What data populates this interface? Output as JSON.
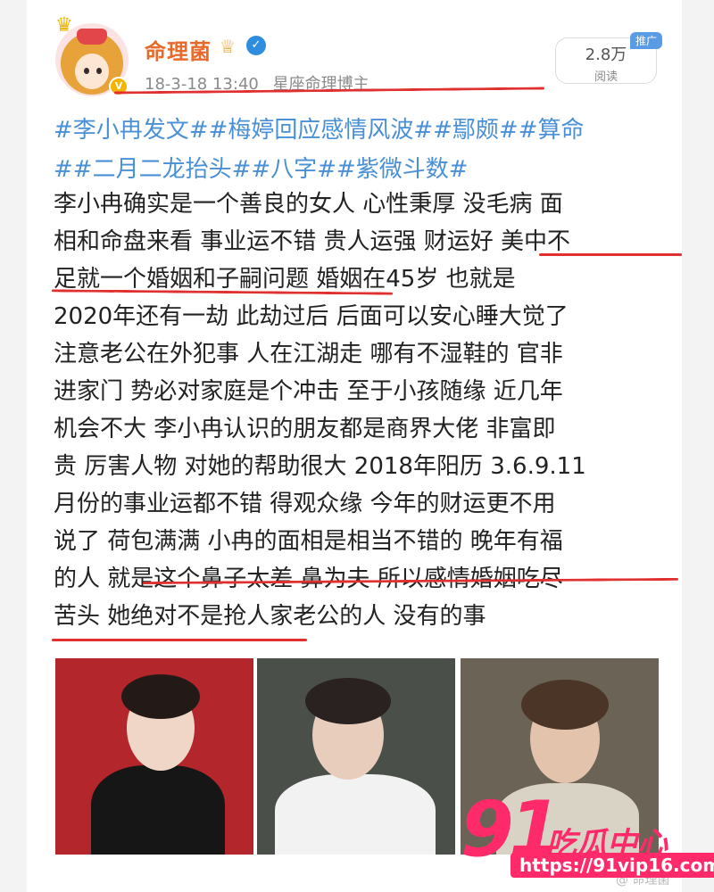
{
  "post": {
    "username": "命理菌",
    "date": "18-3-18 13:40",
    "description": "星座命理博主",
    "read_count": "2.8万",
    "read_label": "阅读",
    "promo_tag": "推广",
    "hashtags_line1": "#李小冉发文##梅婷回应感情风波##鄢颇##算命",
    "hashtags_line2": "##二月二龙抬头##八字##紫微斗数#",
    "body_lines": [
      "李小冉确实是一个善良的女人 心性秉厚 没毛病 面",
      "相和命盘来看 事业运不错 贵人运强 财运好 美中不",
      "足就一个婚姻和子嗣问题 婚姻在45岁 也就是",
      "2020年还有一劫 此劫过后 后面可以安心睡大觉了",
      "注意老公在外犯事 人在江湖走 哪有不湿鞋的 官非",
      "进家门 势必对家庭是个冲击 至于小孩随缘 近几年",
      "机会不大 李小冉认识的朋友都是商界大佬 非富即",
      "贵 厉害人物 对她的帮助很大 2018年阳历 3.6.9.11",
      "月份的事业运都不错 得观众缘 今年的财运更不用",
      "说了 荷包满满 小冉的面相是相当不错的 晚年有福",
      "的人 就是这个鼻子太差 鼻为夫 所以感情婚姻吃尽",
      "苦头 她绝对不是抢人家老公的人 没有的事"
    ]
  },
  "watermark": {
    "number": "91",
    "name": "吃瓜中心",
    "url": "https://91vip16.com"
  },
  "colors": {
    "username": "#e86a2b",
    "hashtag": "#4a90d6",
    "underline": "#e03030",
    "watermark": "#ff2a6a"
  }
}
